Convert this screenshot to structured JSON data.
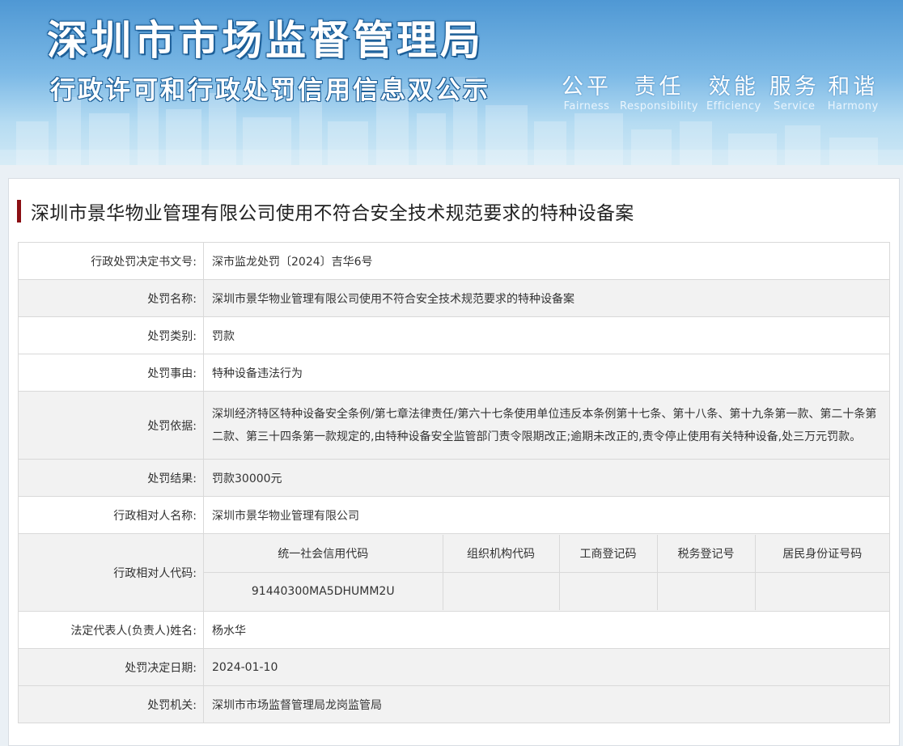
{
  "banner": {
    "title1": "深圳市市场监督管理局",
    "title2": "行政许可和行政处罚信用信息双公示",
    "mottos": [
      {
        "cn": "公平",
        "en": "Fairness"
      },
      {
        "cn": "责任",
        "en": "Responsibility"
      },
      {
        "cn": "效能",
        "en": "Efficiency"
      },
      {
        "cn": "服务",
        "en": "Service"
      },
      {
        "cn": "和谐",
        "en": "Harmony"
      }
    ]
  },
  "page_title": "深圳市景华物业管理有限公司使用不符合安全技术规范要求的特种设备案",
  "rows": {
    "doc_no": {
      "label": "行政处罚决定书文号:",
      "value": "深市监龙处罚〔2024〕吉华6号"
    },
    "name": {
      "label": "处罚名称:",
      "value": "深圳市景华物业管理有限公司使用不符合安全技术规范要求的特种设备案"
    },
    "type": {
      "label": "处罚类别:",
      "value": "罚款"
    },
    "reason": {
      "label": "处罚事由:",
      "value": "特种设备违法行为"
    },
    "basis": {
      "label": "处罚依据:",
      "value": "深圳经济特区特种设备安全条例/第七章法律责任/第六十七条使用单位违反本条例第十七条、第十八条、第十九条第一款、第二十条第二款、第三十四条第一款规定的,由特种设备安全监管部门责令限期改正;逾期未改正的,责令停止使用有关特种设备,处三万元罚款。"
    },
    "result": {
      "label": "处罚结果:",
      "value": "罚款30000元"
    },
    "party_name": {
      "label": "行政相对人名称:",
      "value": "深圳市景华物业管理有限公司"
    },
    "party_code": {
      "label": "行政相对人代码:",
      "headers": [
        "统一社会信用代码",
        "组织机构代码",
        "工商登记码",
        "税务登记号",
        "居民身份证号码"
      ],
      "values": [
        "91440300MA5DHUMM2U",
        "",
        "",
        "",
        ""
      ]
    },
    "legal_rep": {
      "label": "法定代表人(负责人)姓名:",
      "value": "杨水华"
    },
    "date": {
      "label": "处罚决定日期:",
      "value": "2024-01-10"
    },
    "authority": {
      "label": "处罚机关:",
      "value": "深圳市市场监督管理局龙岗监管局"
    }
  },
  "colors": {
    "accent": "#8b0f14",
    "banner_blue": "#4f98d4",
    "row_alt": "#f2f2f2"
  }
}
